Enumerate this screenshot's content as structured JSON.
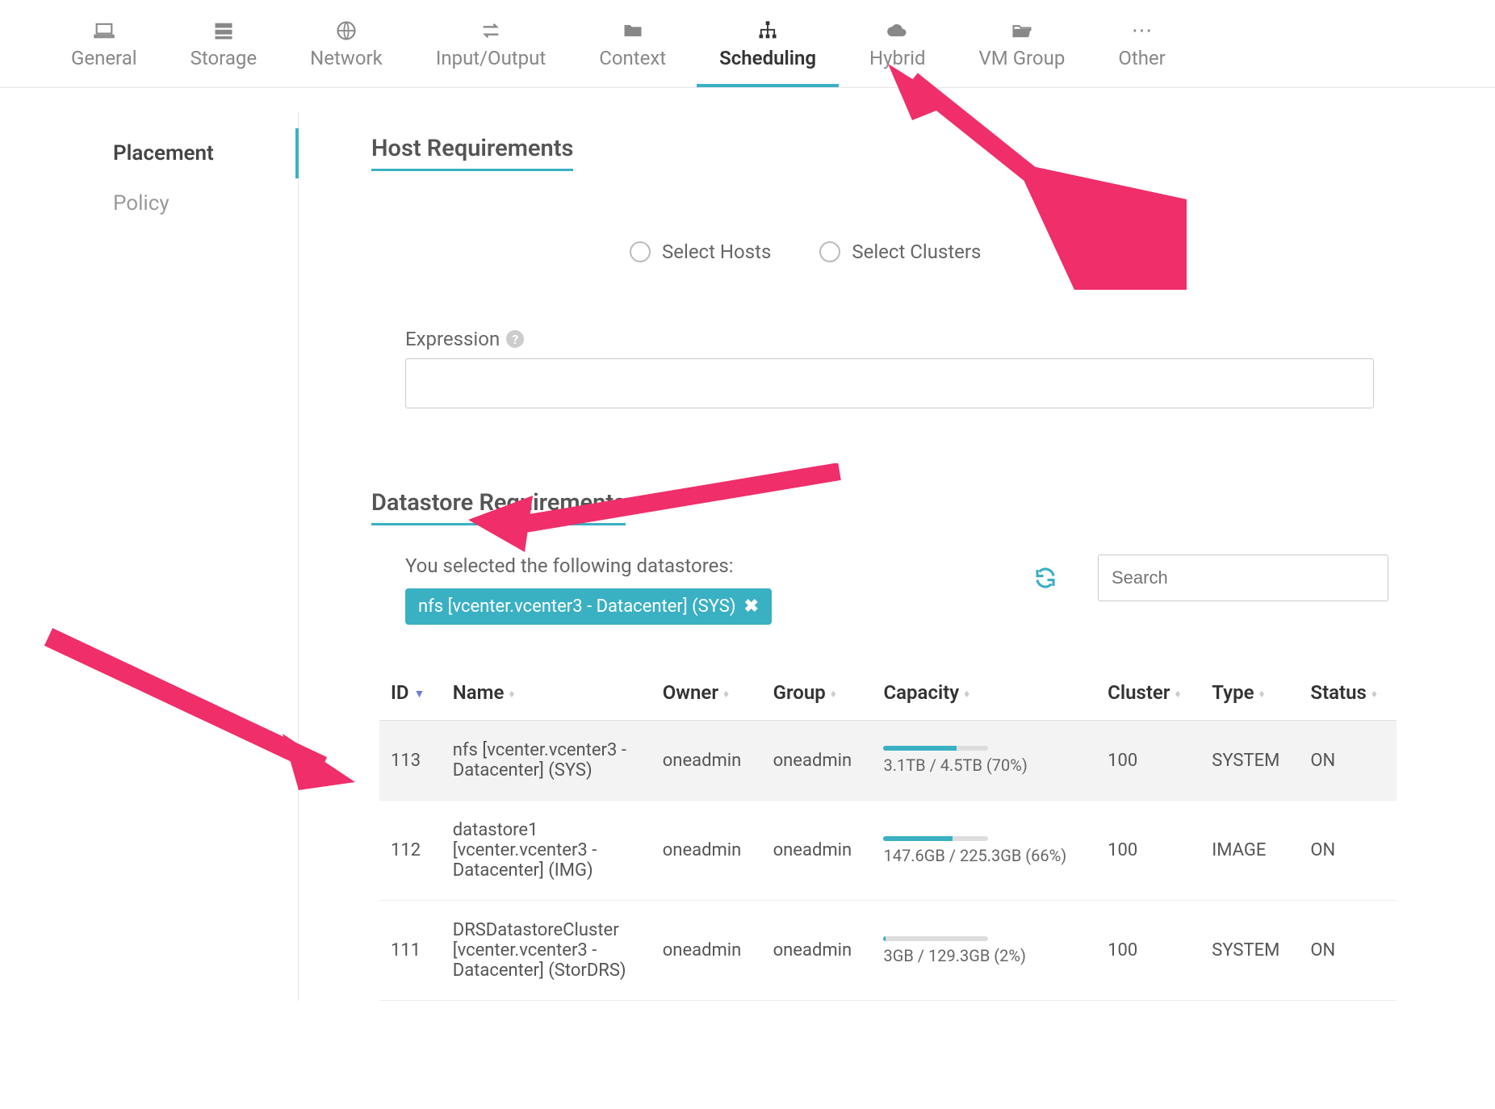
{
  "tabs": [
    {
      "label": "General",
      "icon": "laptop"
    },
    {
      "label": "Storage",
      "icon": "server"
    },
    {
      "label": "Network",
      "icon": "globe"
    },
    {
      "label": "Input/Output",
      "icon": "exchange"
    },
    {
      "label": "Context",
      "icon": "folder"
    },
    {
      "label": "Scheduling",
      "icon": "sitemap",
      "active": true
    },
    {
      "label": "Hybrid",
      "icon": "cloud"
    },
    {
      "label": "VM Group",
      "icon": "folder-open"
    },
    {
      "label": "Other",
      "icon": "ellipsis"
    }
  ],
  "sidebar": [
    {
      "label": "Placement",
      "active": true
    },
    {
      "label": "Policy"
    }
  ],
  "host_req": {
    "title": "Host Requirements",
    "radio_hosts": "Select Hosts",
    "radio_clusters": "Select Clusters",
    "expr_label": "Expression",
    "expr_value": ""
  },
  "ds_req": {
    "title": "Datastore Requirements",
    "selected_text": "You selected the following datastores:",
    "chip_label": "nfs [vcenter.vcenter3 - Datacenter] (SYS)",
    "search_placeholder": "Search"
  },
  "columns": [
    "ID",
    "Name",
    "Owner",
    "Group",
    "Capacity",
    "Cluster",
    "Type",
    "Status"
  ],
  "rows": [
    {
      "id": "113",
      "name": "nfs [vcenter.vcenter3 - Datacenter] (SYS)",
      "owner": "oneadmin",
      "group": "oneadmin",
      "capacity": "3.1TB / 4.5TB (70%)",
      "cap_pct": 70,
      "cluster": "100",
      "type": "SYSTEM",
      "status": "ON",
      "selected": true
    },
    {
      "id": "112",
      "name": "datastore1 [vcenter.vcenter3 - Datacenter] (IMG)",
      "owner": "oneadmin",
      "group": "oneadmin",
      "capacity": "147.6GB / 225.3GB (66%)",
      "cap_pct": 66,
      "cluster": "100",
      "type": "IMAGE",
      "status": "ON"
    },
    {
      "id": "111",
      "name": "DRSDatastoreCluster [vcenter.vcenter3 - Datacenter] (StorDRS)",
      "owner": "oneadmin",
      "group": "oneadmin",
      "capacity": "3GB / 129.3GB (2%)",
      "cap_pct": 2,
      "cluster": "100",
      "type": "SYSTEM",
      "status": "ON"
    }
  ]
}
